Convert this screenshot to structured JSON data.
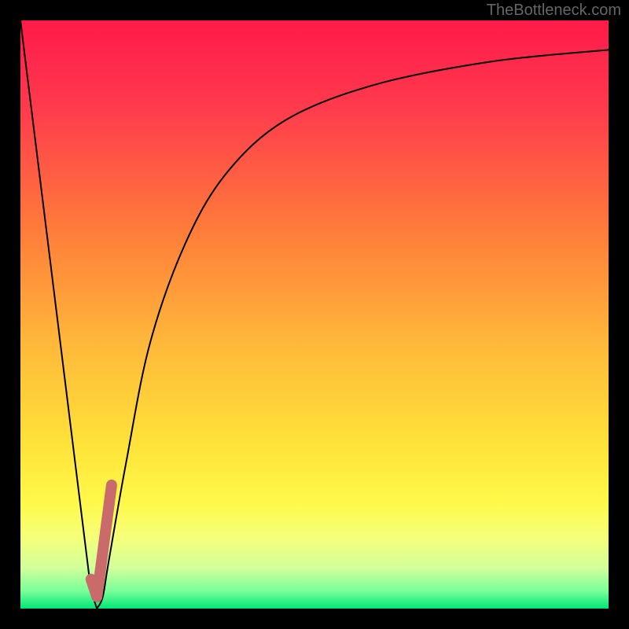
{
  "watermark": "TheBottleneck.com",
  "chart_data": {
    "type": "line",
    "title": "",
    "xlabel": "",
    "ylabel": "",
    "xlim": [
      0,
      100
    ],
    "ylim": [
      0,
      100
    ],
    "series": [
      {
        "name": "bottleneck-curve",
        "x": [
          0,
          12,
          13,
          14,
          15,
          18,
          22,
          28,
          35,
          45,
          60,
          80,
          100
        ],
        "values": [
          100,
          3,
          0,
          2,
          8,
          25,
          45,
          62,
          74,
          83,
          89,
          93,
          95
        ]
      }
    ],
    "marker": {
      "name": "highlight-segment",
      "x": [
        12,
        13,
        15.5
      ],
      "values": [
        5,
        2,
        21
      ],
      "color": "#c96b6b"
    },
    "gradient_stops": [
      {
        "offset": 0,
        "color": "#ff1a4a"
      },
      {
        "offset": 15,
        "color": "#ff3b4d"
      },
      {
        "offset": 35,
        "color": "#ff7a3a"
      },
      {
        "offset": 55,
        "color": "#ffb83a"
      },
      {
        "offset": 72,
        "color": "#ffe23a"
      },
      {
        "offset": 82,
        "color": "#fff94a"
      },
      {
        "offset": 88,
        "color": "#f4ff7a"
      },
      {
        "offset": 93,
        "color": "#d4ff9a"
      },
      {
        "offset": 97,
        "color": "#7aff9a"
      },
      {
        "offset": 100,
        "color": "#00e676"
      }
    ]
  }
}
